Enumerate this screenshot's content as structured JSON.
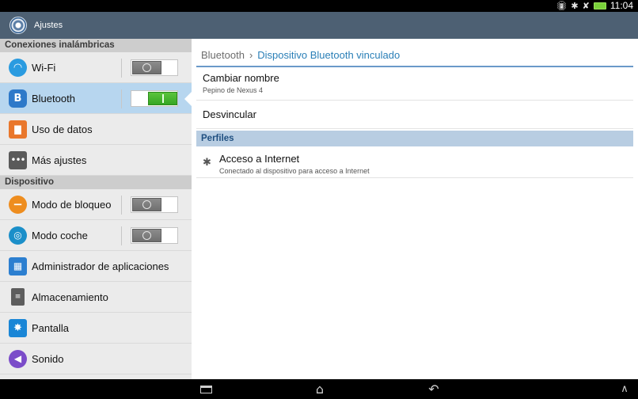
{
  "status_bar": {
    "time": "11:04",
    "icons": [
      "vibrate-icon",
      "bluetooth-icon",
      "no-signal-icon",
      "battery-icon"
    ]
  },
  "action_bar": {
    "title": "Ajustes",
    "icon": "settings-gear-icon"
  },
  "sidebar": {
    "sections": [
      {
        "header": "Conexiones inalámbricas",
        "items": [
          {
            "label": "Wi-Fi",
            "icon": "wifi-icon",
            "toggle": "off"
          },
          {
            "label": "Bluetooth",
            "icon": "bluetooth-icon",
            "toggle": "on",
            "selected": true
          },
          {
            "label": "Uso de datos",
            "icon": "data-usage-icon"
          },
          {
            "label": "Más ajustes",
            "icon": "more-settings-icon"
          }
        ]
      },
      {
        "header": "Dispositivo",
        "items": [
          {
            "label": "Modo de bloqueo",
            "icon": "blocking-mode-icon",
            "toggle": "off"
          },
          {
            "label": "Modo coche",
            "icon": "driving-mode-icon",
            "toggle": "off"
          },
          {
            "label": "Administrador de aplicaciones",
            "icon": "app-manager-icon"
          },
          {
            "label": "Almacenamiento",
            "icon": "storage-icon"
          },
          {
            "label": "Pantalla",
            "icon": "display-icon"
          },
          {
            "label": "Sonido",
            "icon": "sound-icon"
          }
        ]
      }
    ]
  },
  "detail": {
    "breadcrumb": {
      "parent": "Bluetooth",
      "current": "Dispositivo Bluetooth vinculado"
    },
    "rename": {
      "title": "Cambiar nombre",
      "summary": "Pepino de Nexus 4"
    },
    "unpair": {
      "title": "Desvincular"
    },
    "profiles_header": "Perfiles",
    "internet_access": {
      "title": "Acceso a Internet",
      "summary": "Conectado al dispositivo para acceso a Internet"
    }
  },
  "colors": {
    "action_bar": "#4d6073",
    "selected_item": "#b7d6ef",
    "accent_link": "#2a7fb7",
    "toggle_on": "#43b32c"
  }
}
